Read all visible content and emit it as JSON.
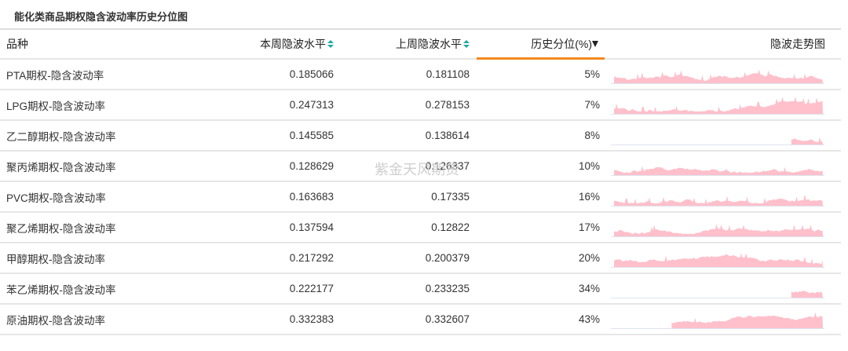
{
  "title": "能化类商品期权隐含波动率历史分位图",
  "watermark": "紫金天风期货",
  "columns": {
    "name": "品种",
    "this_week": "本周隐波水平",
    "last_week": "上周隐波水平",
    "percentile": "历史分位(%)",
    "trend": "隐波走势图"
  },
  "colors": {
    "sparkline": "#ffc0cb",
    "accent": "#f08a1c",
    "sort": "#1fa8a0"
  },
  "rows": [
    {
      "name": "PTA期权-隐含波动率",
      "this_week": "0.185066",
      "last_week": "0.181108",
      "percentile": "5%"
    },
    {
      "name": "LPG期权-隐含波动率",
      "this_week": "0.247313",
      "last_week": "0.278153",
      "percentile": "7%"
    },
    {
      "name": "乙二醇期权-隐含波动率",
      "this_week": "0.145585",
      "last_week": "0.138614",
      "percentile": "8%"
    },
    {
      "name": "聚丙烯期权-隐含波动率",
      "this_week": "0.128629",
      "last_week": "0.126337",
      "percentile": "10%"
    },
    {
      "name": "PVC期权-隐含波动率",
      "this_week": "0.163683",
      "last_week": "0.17335",
      "percentile": "16%"
    },
    {
      "name": "聚乙烯期权-隐含波动率",
      "this_week": "0.137594",
      "last_week": "0.12822",
      "percentile": "17%"
    },
    {
      "name": "甲醇期权-隐含波动率",
      "this_week": "0.217292",
      "last_week": "0.200379",
      "percentile": "20%"
    },
    {
      "name": "苯乙烯期权-隐含波动率",
      "this_week": "0.222177",
      "last_week": "0.233235",
      "percentile": "34%"
    },
    {
      "name": "原油期权-隐含波动率",
      "this_week": "0.332383",
      "last_week": "0.332607",
      "percentile": "43%"
    }
  ]
}
